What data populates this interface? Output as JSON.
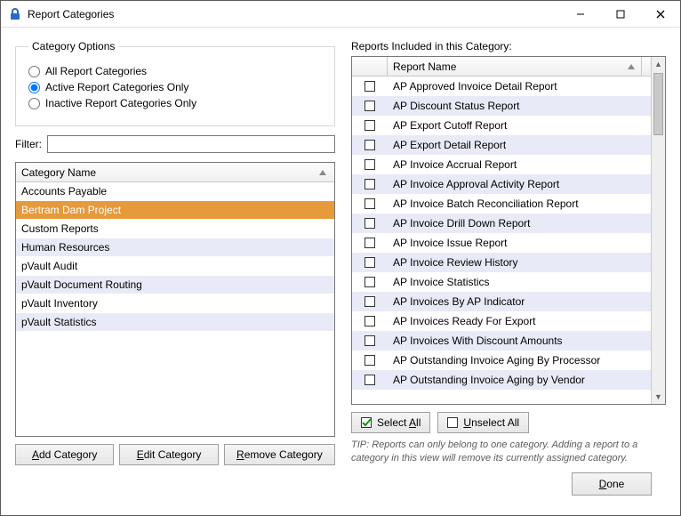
{
  "window": {
    "title": "Report Categories"
  },
  "groupbox": {
    "legend": "Category Options",
    "options": [
      {
        "label": "All Report Categories",
        "selected": false
      },
      {
        "label": "Active Report Categories Only",
        "selected": true
      },
      {
        "label": "Inactive Report Categories Only",
        "selected": false
      }
    ]
  },
  "filter": {
    "label": "Filter:",
    "value": ""
  },
  "categories": {
    "header": "Category Name",
    "items": [
      {
        "name": "Accounts Payable",
        "selected": false
      },
      {
        "name": "Bertram Dam Project",
        "selected": true
      },
      {
        "name": "Custom Reports",
        "selected": false
      },
      {
        "name": "Human Resources",
        "selected": false
      },
      {
        "name": "pVault Audit",
        "selected": false
      },
      {
        "name": "pVault Document Routing",
        "selected": false
      },
      {
        "name": "pVault Inventory",
        "selected": false
      },
      {
        "name": "pVault Statistics",
        "selected": false
      }
    ]
  },
  "cat_buttons": {
    "add": {
      "und": "A",
      "rest": "dd Category"
    },
    "edit": {
      "und": "E",
      "rest": "dit Category"
    },
    "remove": {
      "und": "R",
      "rest": "emove Category"
    }
  },
  "reports": {
    "label": "Reports Included in this Category:",
    "header": "Report Name",
    "items": [
      "AP Approved Invoice Detail Report",
      "AP Discount Status Report",
      "AP Export Cutoff Report",
      "AP Export Detail Report",
      "AP Invoice Accrual Report",
      "AP Invoice Approval Activity Report",
      "AP Invoice Batch Reconciliation Report",
      "AP Invoice Drill Down Report",
      "AP Invoice Issue Report",
      "AP Invoice Review History",
      "AP Invoice Statistics",
      "AP Invoices By AP Indicator",
      "AP Invoices Ready For Export",
      "AP Invoices With Discount Amounts",
      "AP Outstanding Invoice Aging By Processor",
      "AP Outstanding Invoice Aging by Vendor"
    ]
  },
  "sel_buttons": {
    "select": {
      "pre": "Select ",
      "und": "A",
      "post": "ll"
    },
    "unselect": {
      "pre": "",
      "und": "U",
      "post": "nselect All"
    }
  },
  "tip": "TIP:  Reports can only belong to one category.  Adding a report to a category in this view will remove its currently assigned category.",
  "footer": {
    "done": {
      "und": "D",
      "rest": "one"
    }
  }
}
